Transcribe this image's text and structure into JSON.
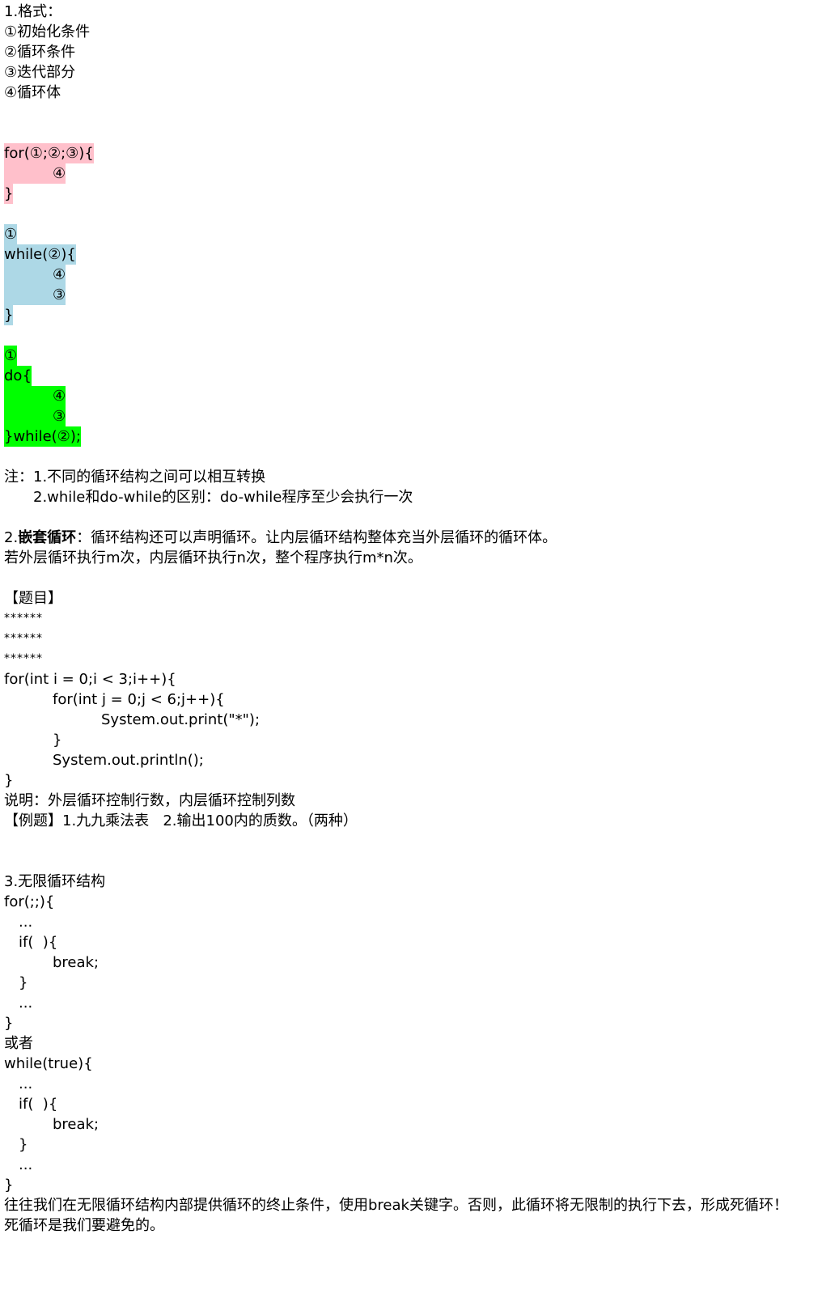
{
  "section1": {
    "title": "1.格式：",
    "items": [
      "①初始化条件",
      "②循环条件",
      "③迭代部分",
      "④循环体"
    ]
  },
  "for_block": {
    "line1": "for(①;②;③){",
    "line2": "④",
    "line3": "}",
    "color": "#ffc0cb"
  },
  "while_block": {
    "line1": "①",
    "line2": "while(②){",
    "line3": "④",
    "line4": "③",
    "line5": "}",
    "color": "#add8e6"
  },
  "do_block": {
    "line1": "①",
    "line2": "do{",
    "line3": "④",
    "line4": "③",
    "line5": "}while(②);",
    "color": "#00ff00"
  },
  "note": {
    "line1": "注：1.不同的循环结构之间可以相互转换",
    "line2": "2.while和do-while的区别：do-while程序至少会执行一次"
  },
  "section2": {
    "prefix": "2.",
    "bold": "嵌套循环",
    "rest": "：循环结构还可以声明循环。让内层循环结构整体充当外层循环的循环体。",
    "line2": "若外层循环执行m次，内层循环执行n次，整个程序执行m*n次。"
  },
  "exercise": {
    "title": "【题目】",
    "stars": [
      "******",
      "******",
      "******"
    ],
    "code": [
      "for(int i = 0;i < 3;i++){",
      "for(int j = 0;j < 6;j++){",
      "System.out.print(\"*\");",
      "}",
      "System.out.println();",
      "}"
    ],
    "explain": "说明：外层循环控制行数，内层循环控制列数",
    "examples": "【例题】1.九九乘法表   2.输出100内的质数。（两种）"
  },
  "section3": {
    "title": "3.无限循环结构",
    "for_code": [
      "for(;;){",
      "...",
      "if(  ){",
      "break;",
      "}",
      "...",
      "}"
    ],
    "or": "或者",
    "while_code": [
      "while(true){",
      "...",
      "if(  ){",
      "break;",
      "}",
      "...",
      "}"
    ],
    "conclusion1": "往往我们在无限循环结构内部提供循环的终止条件，使用break关键字。否则，此循环将无限制的执行下去，形成死循环！",
    "conclusion2": "死循环是我们要避免的。"
  }
}
